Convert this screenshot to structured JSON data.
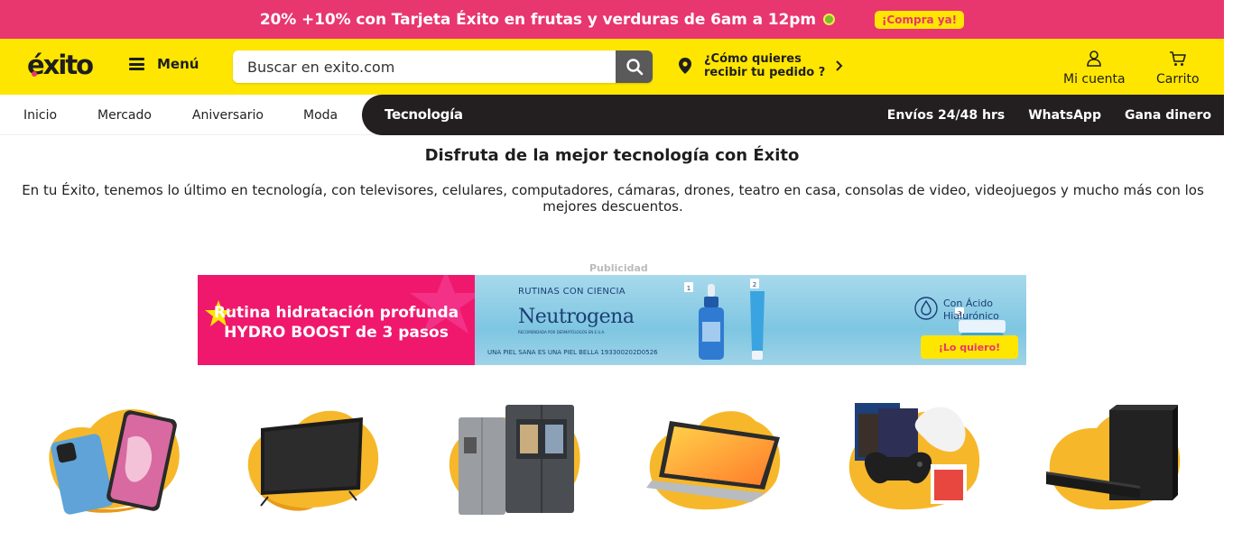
{
  "promo": {
    "text": "20% +10% con Tarjeta Éxito en frutas y verduras de 6am a 12pm",
    "button": "¡Compra ya!"
  },
  "header": {
    "logo": "éxito",
    "menu_label": "Menú",
    "search_placeholder": "Buscar en exito.com",
    "delivery_line1": "¿Cómo quieres",
    "delivery_line2": "recibir tu pedido ?",
    "account_label": "Mi cuenta",
    "cart_label": "Carrito"
  },
  "nav": {
    "items": [
      "Inicio",
      "Mercado",
      "Aniversario",
      "Moda"
    ],
    "active": "Tecnología",
    "right_items": [
      "Envíos 24/48 hrs",
      "WhatsApp",
      "Gana dinero"
    ]
  },
  "main": {
    "title": "Disfruta de la mejor tecnología con Éxito",
    "description": "En tu Éxito, tenemos lo último en tecnología, con televisores, celulares, computadores, cámaras, drones, teatro en casa, consolas de video, videojuegos y mucho más con los mejores descuentos.",
    "ad_label": "Publicidad"
  },
  "banner": {
    "left_line1": "Rutina hidratación profunda",
    "left_line2": "HYDRO BOOST de 3 pasos",
    "rutinas": "RUTINAS CON CIENCIA",
    "brand": "Neutrogena",
    "brand_sub": "RECOMENDADA POR DERMATÓLOGOS EN E.U.A.",
    "legal": "UNA PIEL SANA ES UNA PIEL BELLA 193300202D0526",
    "step1": "1",
    "step2": "2",
    "step3": "3",
    "acido_line1": "Con Ácido",
    "acido_line2": "Hialurónico",
    "cta": "¡Lo quiero!"
  },
  "categories": [
    {
      "icon": "smartphones-icon"
    },
    {
      "icon": "television-icon"
    },
    {
      "icon": "refrigerator-icon"
    },
    {
      "icon": "laptop-icon"
    },
    {
      "icon": "videogames-icon"
    },
    {
      "icon": "soundbar-icon"
    }
  ],
  "colors": {
    "promo_bg": "#e8366f",
    "header_bg": "#ffe600",
    "nav_dark": "#231f20",
    "banner_pink": "#f0186d",
    "category_blob": "#f6b82a"
  }
}
